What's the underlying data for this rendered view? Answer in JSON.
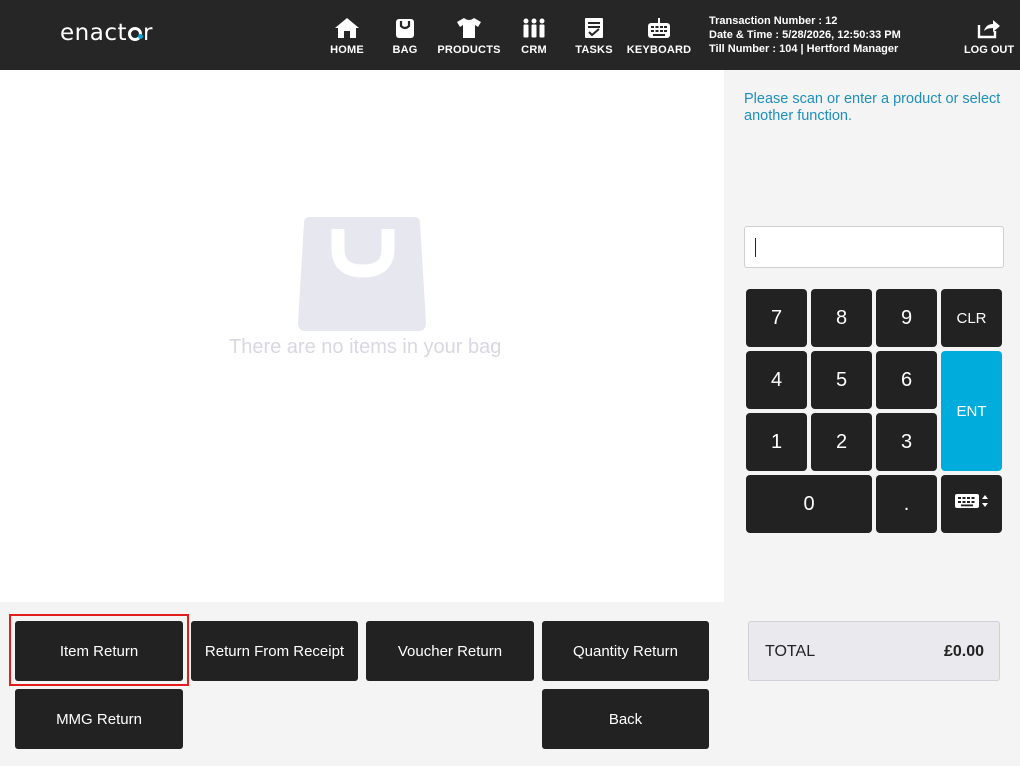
{
  "header": {
    "logo": {
      "pre": "enact",
      "post": "r"
    },
    "nav": [
      {
        "id": "home",
        "label": "HOME",
        "icon": "home-icon"
      },
      {
        "id": "bag",
        "label": "BAG",
        "icon": "bag-icon"
      },
      {
        "id": "products",
        "label": "PRODUCTS",
        "icon": "shirt-icon"
      },
      {
        "id": "crm",
        "label": "CRM",
        "icon": "people-icon"
      },
      {
        "id": "tasks",
        "label": "TASKS",
        "icon": "tasks-icon"
      },
      {
        "id": "keyboard",
        "label": "KEYBOARD",
        "icon": "keyboard-icon"
      }
    ],
    "transaction": {
      "line1": "Transaction Number : 12",
      "line2": "Date & Time : 5/28/2026, 12:50:33 PM",
      "line3": "Till Number : 104  |  Hertford Manager"
    },
    "logout_label": "LOG OUT"
  },
  "bag": {
    "empty_message": "There are no items in your bag"
  },
  "functions": {
    "item_return": "Item Return",
    "return_from_receipt": "Return From Receipt",
    "voucher_return": "Voucher Return",
    "quantity_return": "Quantity Return",
    "mmg_return": "MMG Return",
    "back": "Back"
  },
  "right_panel": {
    "prompt": "Please scan or enter a product or select another function.",
    "input_value": "",
    "keypad": {
      "k7": "7",
      "k8": "8",
      "k9": "9",
      "clr": "CLR",
      "k4": "4",
      "k5": "5",
      "k6": "6",
      "ent": "ENT",
      "k1": "1",
      "k2": "2",
      "k3": "3",
      "k0": "0",
      "dot": "."
    },
    "total_label": "TOTAL",
    "total_value": "£0.00"
  },
  "colors": {
    "header_bg": "#262626",
    "accent": "#00acdc",
    "prompt_text": "#1d8fbf",
    "selected_outline": "#e21d1d"
  }
}
